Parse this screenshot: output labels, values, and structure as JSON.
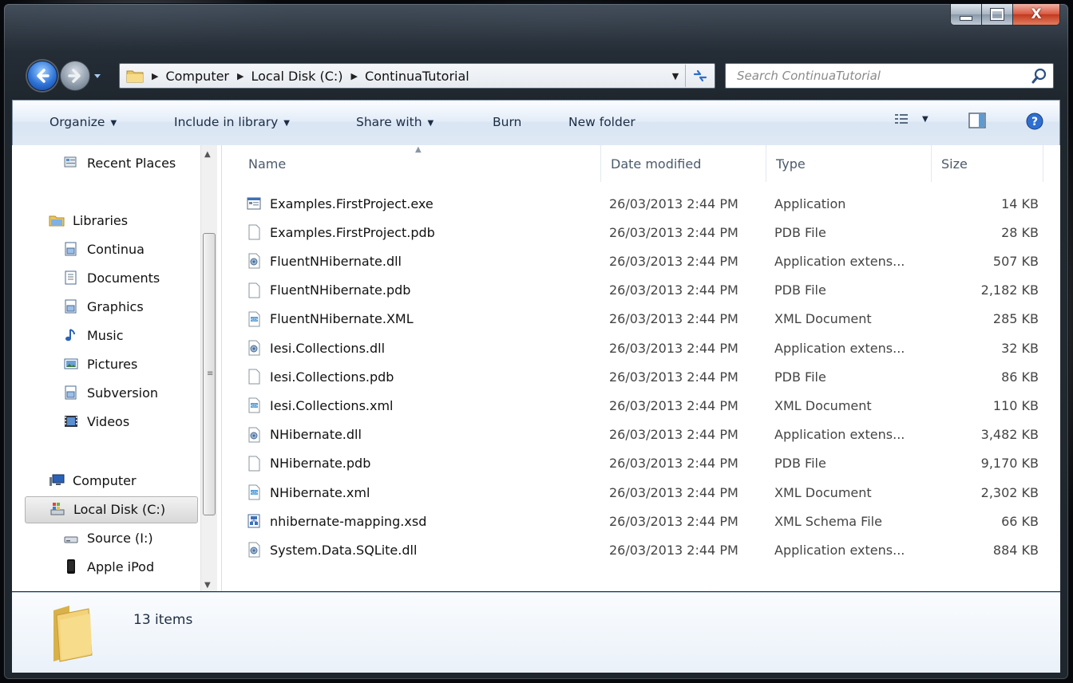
{
  "window": {
    "caption": {
      "minimize": "minimize",
      "maximize": "maximize",
      "close": "X"
    }
  },
  "address": {
    "crumbs": [
      "Computer",
      "Local Disk (C:)",
      "ContinuaTutorial"
    ]
  },
  "search": {
    "placeholder": "Search ContinuaTutorial"
  },
  "toolbar": {
    "organize": "Organize",
    "include_in_library": "Include in library",
    "share_with": "Share with",
    "burn": "Burn",
    "new_folder": "New folder"
  },
  "nav": {
    "recent_places": "Recent Places",
    "libraries": "Libraries",
    "library_items": [
      "Continua",
      "Documents",
      "Graphics",
      "Music",
      "Pictures",
      "Subversion",
      "Videos"
    ],
    "computer": "Computer",
    "computer_items": [
      "Local Disk (C:)",
      "Source (I:)",
      "Apple iPod"
    ]
  },
  "columns": {
    "name": "Name",
    "date": "Date modified",
    "type": "Type",
    "size": "Size"
  },
  "files": [
    {
      "name": "Examples.FirstProject.exe",
      "date": "26/03/2013 2:44 PM",
      "type": "Application",
      "size": "14 KB",
      "icon": "exe-icon"
    },
    {
      "name": "Examples.FirstProject.pdb",
      "date": "26/03/2013 2:44 PM",
      "type": "PDB File",
      "size": "28 KB",
      "icon": "blank-file-icon"
    },
    {
      "name": "FluentNHibernate.dll",
      "date": "26/03/2013 2:44 PM",
      "type": "Application extens...",
      "size": "507 KB",
      "icon": "dll-icon"
    },
    {
      "name": "FluentNHibernate.pdb",
      "date": "26/03/2013 2:44 PM",
      "type": "PDB File",
      "size": "2,182 KB",
      "icon": "blank-file-icon"
    },
    {
      "name": "FluentNHibernate.XML",
      "date": "26/03/2013 2:44 PM",
      "type": "XML Document",
      "size": "285 KB",
      "icon": "xml-icon"
    },
    {
      "name": "Iesi.Collections.dll",
      "date": "26/03/2013 2:44 PM",
      "type": "Application extens...",
      "size": "32 KB",
      "icon": "dll-icon"
    },
    {
      "name": "Iesi.Collections.pdb",
      "date": "26/03/2013 2:44 PM",
      "type": "PDB File",
      "size": "86 KB",
      "icon": "blank-file-icon"
    },
    {
      "name": "Iesi.Collections.xml",
      "date": "26/03/2013 2:44 PM",
      "type": "XML Document",
      "size": "110 KB",
      "icon": "xml-icon"
    },
    {
      "name": "NHibernate.dll",
      "date": "26/03/2013 2:44 PM",
      "type": "Application extens...",
      "size": "3,482 KB",
      "icon": "dll-icon"
    },
    {
      "name": "NHibernate.pdb",
      "date": "26/03/2013 2:44 PM",
      "type": "PDB File",
      "size": "9,170 KB",
      "icon": "blank-file-icon"
    },
    {
      "name": "NHibernate.xml",
      "date": "26/03/2013 2:44 PM",
      "type": "XML Document",
      "size": "2,302 KB",
      "icon": "xml-icon"
    },
    {
      "name": "nhibernate-mapping.xsd",
      "date": "26/03/2013 2:44 PM",
      "type": "XML Schema File",
      "size": "66 KB",
      "icon": "xsd-icon"
    },
    {
      "name": "System.Data.SQLite.dll",
      "date": "26/03/2013 2:44 PM",
      "type": "Application extens...",
      "size": "884 KB",
      "icon": "dll-icon"
    }
  ],
  "details": {
    "item_count": "13 items"
  },
  "colors": {
    "accent_blue": "#2f74d8",
    "close_red": "#c03a1f",
    "command_text": "#1c2d44"
  }
}
